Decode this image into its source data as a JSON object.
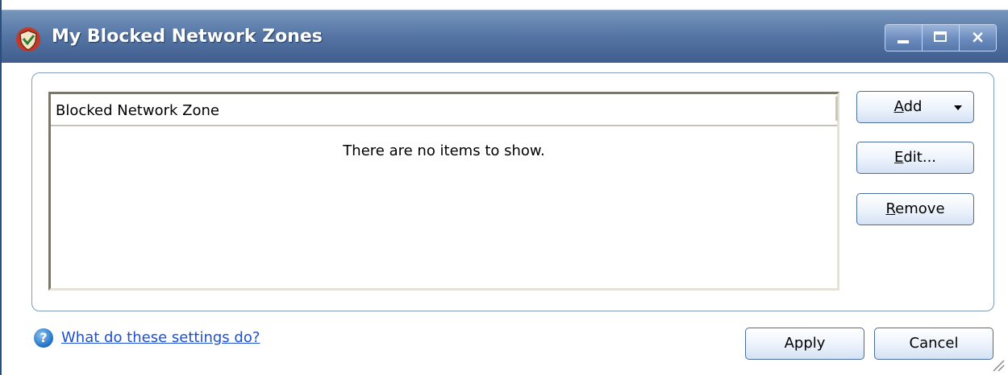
{
  "window": {
    "title": "My Blocked Network Zones",
    "controls": {
      "minimize": "minimize",
      "maximize": "maximize",
      "close": "×"
    }
  },
  "list": {
    "column_header": "Blocked Network Zone",
    "empty_text": "There are no items to show.",
    "items": []
  },
  "buttons": {
    "add": {
      "label": "Add",
      "mnemonic": "A"
    },
    "edit": {
      "label": "Edit...",
      "mnemonic": "E"
    },
    "remove": {
      "label": "Remove",
      "mnemonic": "R"
    },
    "apply": "Apply",
    "cancel": "Cancel"
  },
  "help": {
    "link_text": "What do these settings do?",
    "icon": "help-icon",
    "glyph": "?"
  },
  "colors": {
    "titlebar": "#5777a6",
    "link": "#1f4fcf",
    "border": "#7f9db9"
  }
}
